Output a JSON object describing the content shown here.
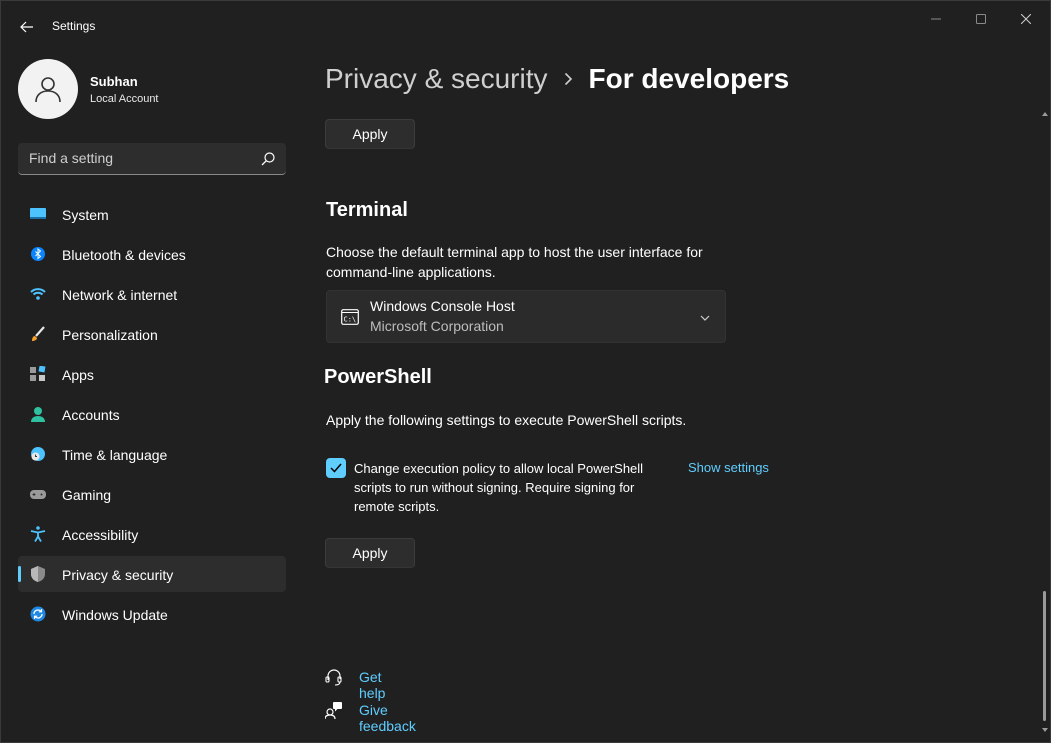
{
  "app": {
    "title": "Settings"
  },
  "profile": {
    "name": "Subhan",
    "account_type": "Local Account"
  },
  "search": {
    "placeholder": "Find a setting"
  },
  "nav": {
    "items": [
      {
        "label": "System",
        "icon": "system-icon"
      },
      {
        "label": "Bluetooth & devices",
        "icon": "bluetooth-icon"
      },
      {
        "label": "Network & internet",
        "icon": "wifi-icon"
      },
      {
        "label": "Personalization",
        "icon": "brush-icon"
      },
      {
        "label": "Apps",
        "icon": "apps-icon"
      },
      {
        "label": "Accounts",
        "icon": "person-icon"
      },
      {
        "label": "Time & language",
        "icon": "globe-clock-icon"
      },
      {
        "label": "Gaming",
        "icon": "gamepad-icon"
      },
      {
        "label": "Accessibility",
        "icon": "accessibility-icon"
      },
      {
        "label": "Privacy & security",
        "icon": "shield-icon",
        "selected": true
      },
      {
        "label": "Windows Update",
        "icon": "refresh-icon"
      }
    ]
  },
  "breadcrumb": {
    "parent": "Privacy & security",
    "current": "For developers"
  },
  "buttons": {
    "apply_top": "Apply",
    "apply_bottom": "Apply"
  },
  "terminal": {
    "title": "Terminal",
    "description": "Choose the default terminal app to host the user interface for command-line applications.",
    "selected_app": "Windows Console Host",
    "selected_publisher": "Microsoft Corporation"
  },
  "powershell": {
    "title": "PowerShell",
    "description": "Apply the following settings to execute PowerShell scripts.",
    "execution_policy_label": "Change execution policy to allow local PowerShell scripts to run without signing. Require signing for remote scripts.",
    "execution_policy_checked": true,
    "show_settings_link": "Show settings"
  },
  "footer": {
    "get_help": "Get help",
    "give_feedback": "Give feedback"
  },
  "colors": {
    "accent": "#60cdff",
    "background": "#202020",
    "card": "#2b2b2b"
  }
}
